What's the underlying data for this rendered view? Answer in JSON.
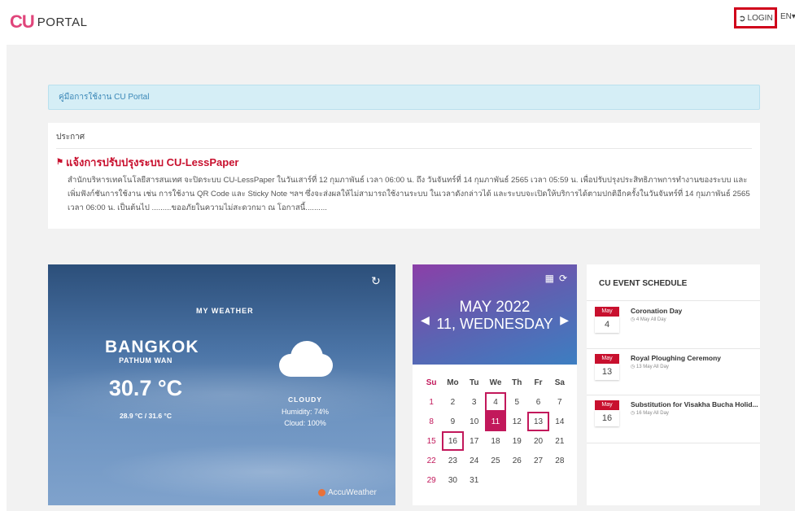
{
  "header": {
    "logo_mark": "CU",
    "logo_text": "PORTAL",
    "login_icon": "login-icon",
    "login_label": "LOGIN",
    "lang": "EN"
  },
  "manual": {
    "link": "คู่มือการใช้งาน CU Portal"
  },
  "announcement": {
    "heading": "ประกาศ",
    "title": "แจ้งการปรับปรุงระบบ CU-LessPaper",
    "body": "สำนักบริหารเทคโนโลยีสารสนเทศ จะปิดระบบ CU-LessPaper ในวันเสาร์ที่ 12 กุมภาพันธ์ เวลา 06:00 น. ถึง วันจันทร์ที่ 14 กุมภาพันธ์ 2565 เวลา 05:59 น. เพื่อปรับปรุงประสิทธิภาพการทำงานของระบบ และเพิ่มฟังก์ชันการใช้งาน เช่น การใช้งาน QR Code และ Sticky Note ฯลฯ ซึ่งจะส่งผลให้ไม่สามารถใช้งานระบบ ในเวลาดังกล่าวได้ และระบบจะเปิดให้บริการได้ตามปกติอีกครั้งในวันจันทร์ที่ 14 กุมภาพันธ์ 2565 เวลา 06:00 น. เป็นต้นไป .........ขออภัยในความไม่สะดวกมา ณ โอกาสนี้.........."
  },
  "weather": {
    "title": "MY WEATHER",
    "city": "BANGKOK",
    "district": "PATHUM WAN",
    "temp": "30.7 °C",
    "range": "28.9 °C / 31.6 °C",
    "condition": "CLOUDY",
    "humidity": "Humidity: 74%",
    "cloud": "Cloud: 100%",
    "brand": "AccuWeather"
  },
  "calendar": {
    "month": "MAY 2022",
    "date": "11, WEDNESDAY",
    "dow": [
      "Su",
      "Mo",
      "Tu",
      "We",
      "Th",
      "Fr",
      "Sa"
    ],
    "weeks": [
      [
        "1",
        "2",
        "3",
        "4",
        "5",
        "6",
        "7"
      ],
      [
        "8",
        "9",
        "10",
        "11",
        "12",
        "13",
        "14"
      ],
      [
        "15",
        "16",
        "17",
        "18",
        "19",
        "20",
        "21"
      ],
      [
        "22",
        "23",
        "24",
        "25",
        "26",
        "27",
        "28"
      ],
      [
        "29",
        "30",
        "31",
        "",
        "",
        "",
        ""
      ]
    ],
    "today": "11",
    "event_days": [
      "4",
      "13",
      "16"
    ],
    "accent": "#c2185b"
  },
  "events": {
    "title": "CU EVENT SCHEDULE",
    "items": [
      {
        "month": "May",
        "day": "4",
        "name": "Coronation Day",
        "meta": "◷ 4 May All Day"
      },
      {
        "month": "May",
        "day": "13",
        "name": "Royal Ploughing Ceremony",
        "meta": "◷ 13 May All Day"
      },
      {
        "month": "May",
        "day": "16",
        "name": "Substitution for Visakha Bucha Holid...",
        "meta": "◷ 16 May All Day"
      }
    ]
  }
}
